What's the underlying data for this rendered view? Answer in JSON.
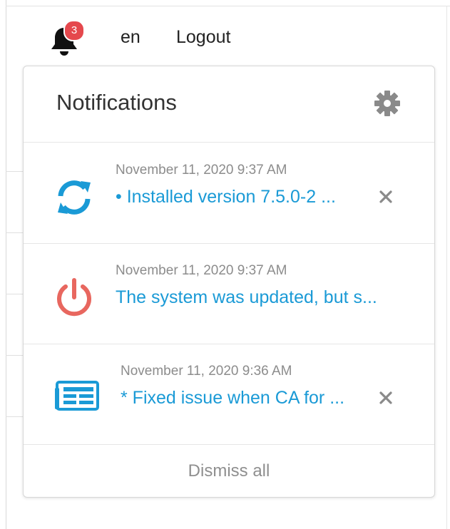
{
  "topbar": {
    "badge_count": "3",
    "language": "en",
    "logout_label": "Logout"
  },
  "popover": {
    "title": "Notifications",
    "dismiss_label": "Dismiss all",
    "items": [
      {
        "time": "November 11, 2020 9:37 AM",
        "text": "• Installed version 7.5.0-2 ...",
        "icon": "refresh-icon",
        "color": "#1a9ad6",
        "closable": true
      },
      {
        "time": "November 11, 2020 9:37 AM",
        "text": "The system was updated, but s...",
        "icon": "power-icon",
        "color": "#e8675f",
        "closable": false
      },
      {
        "time": "November 11, 2020 9:36 AM",
        "text": "* Fixed issue when CA for ...",
        "icon": "news-icon",
        "color": "#1a9ad6",
        "closable": true
      }
    ]
  },
  "colors": {
    "accent": "#1a9ad6",
    "badge": "#e5484d",
    "danger_icon": "#e8675f",
    "muted": "#8c8c8c"
  }
}
